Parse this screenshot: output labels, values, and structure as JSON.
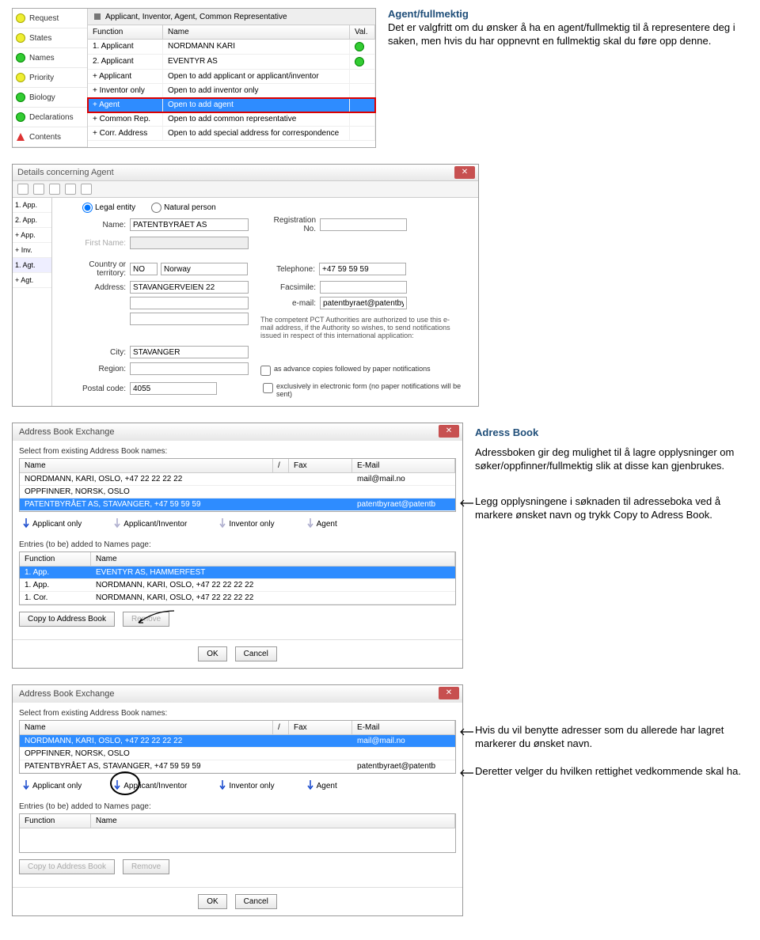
{
  "intro": {
    "heading": "Agent/fullmektig",
    "text": "Det er valgfritt om du ønsker å ha en agent/fullmektig til å representere deg i saken, men hvis du har oppnevnt en fullmektig skal du føre opp denne."
  },
  "app1": {
    "title": "Applicant, Inventor, Agent, Common Representative",
    "sidebar": [
      {
        "label": "Request",
        "dot": "dot-yellow"
      },
      {
        "label": "States",
        "dot": "dot-yellow"
      },
      {
        "label": "Names",
        "dot": "dot-green"
      },
      {
        "label": "Priority",
        "dot": "dot-yellow"
      },
      {
        "label": "Biology",
        "dot": "dot-green"
      },
      {
        "label": "Declarations",
        "dot": "dot-green"
      },
      {
        "label": "Contents",
        "dot": "dot-red"
      }
    ],
    "cols": {
      "func": "Function",
      "name": "Name",
      "val": "Val."
    },
    "rows": [
      {
        "func": "1. Applicant",
        "name": "NORDMANN KARI",
        "val": true
      },
      {
        "func": "2. Applicant",
        "name": "EVENTYR AS",
        "val": true
      },
      {
        "func": "+ Applicant",
        "name": "Open to add applicant or applicant/inventor"
      },
      {
        "func": "+ Inventor only",
        "name": "Open to add inventor only"
      },
      {
        "func": "+ Agent",
        "name": "Open to add agent",
        "sel": true
      },
      {
        "func": "+ Common Rep.",
        "name": "Open to add common representative"
      },
      {
        "func": "+ Corr. Address",
        "name": "Open to add special address for correspondence"
      }
    ]
  },
  "app2": {
    "title": "Details concerning Agent",
    "side": [
      "1. App.",
      "2. App.",
      "+ App.",
      "+ Inv.",
      "1. Agt.",
      "+ Agt."
    ],
    "radio": {
      "legal": "Legal entity",
      "natural": "Natural person"
    },
    "labels": {
      "name": "Name:",
      "firstname": "First Name:",
      "regno": "Registration No.",
      "country": "Country or territory:",
      "tel": "Telephone:",
      "addr": "Address:",
      "fax": "Facsimile:",
      "email": "e-mail:",
      "city": "City:",
      "region": "Region:",
      "postal": "Postal code:"
    },
    "values": {
      "name": "PATENTBYRÅET AS",
      "country_code": "NO",
      "country": "Norway",
      "tel": "+47 59 59 59",
      "addr": "STAVANGERVEIEN 22",
      "email": "patentbyraet@patentbyraet.no",
      "city": "STAVANGER",
      "postal": "4055"
    },
    "pct_note": "The competent PCT Authorities are authorized to use this e-mail address, if the Authority so wishes, to send notifications issued in respect of this international application:",
    "chk1": "as advance copies followed by paper notifications",
    "chk2": "exclusively in electronic form (no paper notifications will be sent)"
  },
  "abx1": {
    "title": "Address Book Exchange",
    "select_label": "Select from existing Address Book names:",
    "cols": {
      "name": "Name",
      "slash": "/",
      "fax": "Fax",
      "email": "E-Mail"
    },
    "rows": [
      {
        "name": "NORDMANN, KARI, OSLO, +47 22 22 22 22",
        "email": "mail@mail.no"
      },
      {
        "name": "OPPFINNER, NORSK, OSLO"
      },
      {
        "name": "PATENTBYRÅET AS, STAVANGER, +47 59 59 59",
        "email": "patentbyraet@patentb",
        "sel": true
      }
    ],
    "opts": [
      "Applicant only",
      "Applicant/Inventor",
      "Inventor only",
      "Agent"
    ],
    "entries_label": "Entries (to be) added to Names page:",
    "entry_cols": {
      "func": "Function",
      "name": "Name"
    },
    "entries": [
      {
        "func": "1. App.",
        "name": "EVENTYR AS, HAMMERFEST",
        "sel": true
      },
      {
        "func": "1. App.",
        "name": "NORDMANN, KARI, OSLO, +47 22 22 22 22"
      },
      {
        "func": "1. Cor.",
        "name": "NORDMANN, KARI, OSLO, +47 22 22 22 22"
      }
    ],
    "btn_copy": "Copy to Address Book",
    "btn_remove": "Remove",
    "btn_ok": "OK",
    "btn_cancel": "Cancel"
  },
  "note_abx1": {
    "heading": "Adress Book",
    "p1": "Adressboken gir deg mulighet til å lagre opplysninger om søker/oppfinner/fullmektig slik at disse kan gjenbrukes.",
    "p2": "Legg opplysningene i søknaden til adresseboka ved å markere ønsket navn og trykk Copy to Adress Book."
  },
  "abx2": {
    "title": "Address Book Exchange",
    "select_label": "Select from existing Address Book names:",
    "cols": {
      "name": "Name",
      "slash": "/",
      "fax": "Fax",
      "email": "E-Mail"
    },
    "rows": [
      {
        "name": "NORDMANN, KARI, OSLO, +47 22 22 22 22",
        "email": "mail@mail.no",
        "sel": true
      },
      {
        "name": "OPPFINNER, NORSK, OSLO"
      },
      {
        "name": "PATENTBYRÅET AS, STAVANGER, +47 59 59 59",
        "email": "patentbyraet@patentb"
      }
    ],
    "opts": [
      "Applicant only",
      "Applicant/Inventor",
      "Inventor only",
      "Agent"
    ],
    "entries_label": "Entries (to be) added to Names page:",
    "entry_cols": {
      "func": "Function",
      "name": "Name"
    },
    "btn_copy": "Copy to Address Book",
    "btn_remove": "Remove",
    "btn_ok": "OK",
    "btn_cancel": "Cancel"
  },
  "note_abx2": {
    "p1": "Hvis du vil benytte adresser som du allerede har lagret markerer du ønsket navn.",
    "p2": "Deretter velger du hvilken rettighet vedkommende skal ha."
  }
}
